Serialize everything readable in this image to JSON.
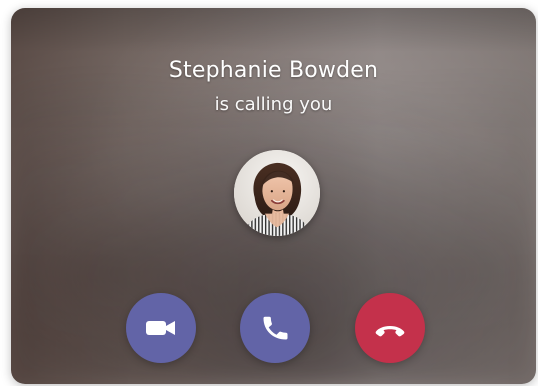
{
  "call": {
    "caller_name": "Stephanie Bowden",
    "subtitle": "is calling you"
  },
  "icons": {
    "accept_video": "video-camera-icon",
    "accept_audio": "phone-icon",
    "decline": "phone-hangup-icon"
  },
  "colors": {
    "primary_button": "#6264a7",
    "decline_button": "#c4314b",
    "text": "#ffffff"
  }
}
